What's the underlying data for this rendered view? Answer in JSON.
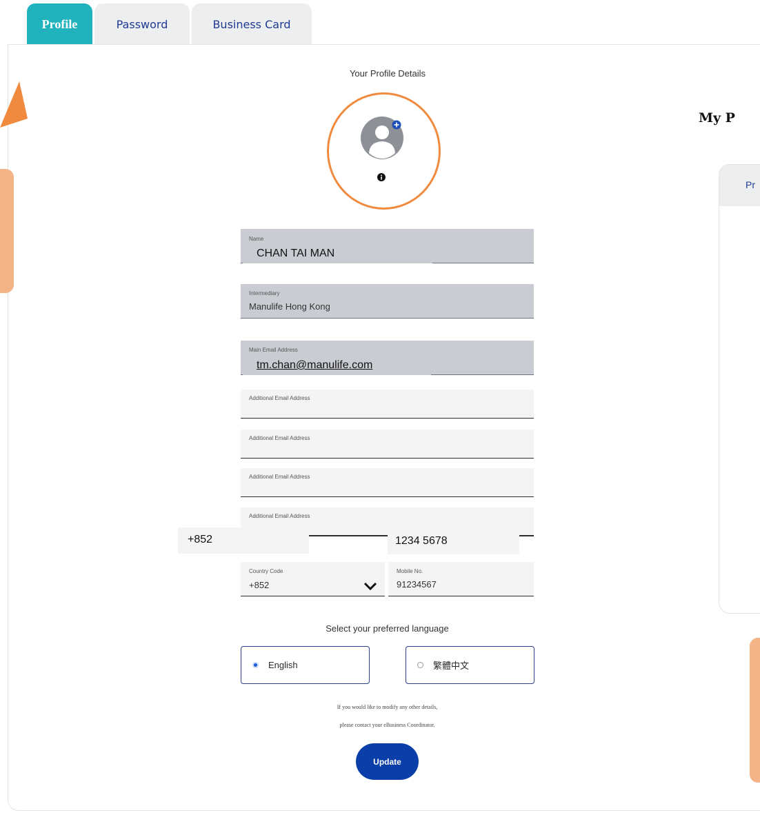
{
  "tabs": [
    {
      "label": "Profile"
    },
    {
      "label": "Password"
    },
    {
      "label": "Business Card"
    }
  ],
  "section_title": "Your Profile Details",
  "avatar": {
    "icon": "user-avatar-icon",
    "add_icon": "plus-circle-icon",
    "info_icon": "info-icon"
  },
  "fields": {
    "name": {
      "label": "Name",
      "value": "CHAN TAI MAN"
    },
    "intermediary": {
      "label": "Intermediary",
      "value": "Manulife Hong Kong"
    },
    "main_email": {
      "label": "Main Email Address",
      "value": "tm.chan@manulife.com"
    },
    "additional_email_label": "Additional Email Address",
    "country_code": {
      "label": "Country Code",
      "value": "+852"
    },
    "mobile": {
      "label": "Mobile No.",
      "value": "91234567"
    }
  },
  "overlay": {
    "country_code": "+852",
    "mobile": "1234 5678"
  },
  "language": {
    "prompt": "Select your preferred language",
    "options": [
      {
        "label": "English",
        "selected": true
      },
      {
        "label": "繁體中文",
        "selected": false
      }
    ]
  },
  "notice": {
    "line1": "If you would like to modify any other details,",
    "line2": "please contact your eBusiness Coordinator."
  },
  "update_label": "Update",
  "right_panel": {
    "heading": "My P",
    "tab_label": "Pr"
  },
  "colors": {
    "accent": "#20b3bd",
    "primary": "#0a3ea8",
    "annotation_orange": "#f08a3e",
    "annotation_light": "#f5b488"
  }
}
